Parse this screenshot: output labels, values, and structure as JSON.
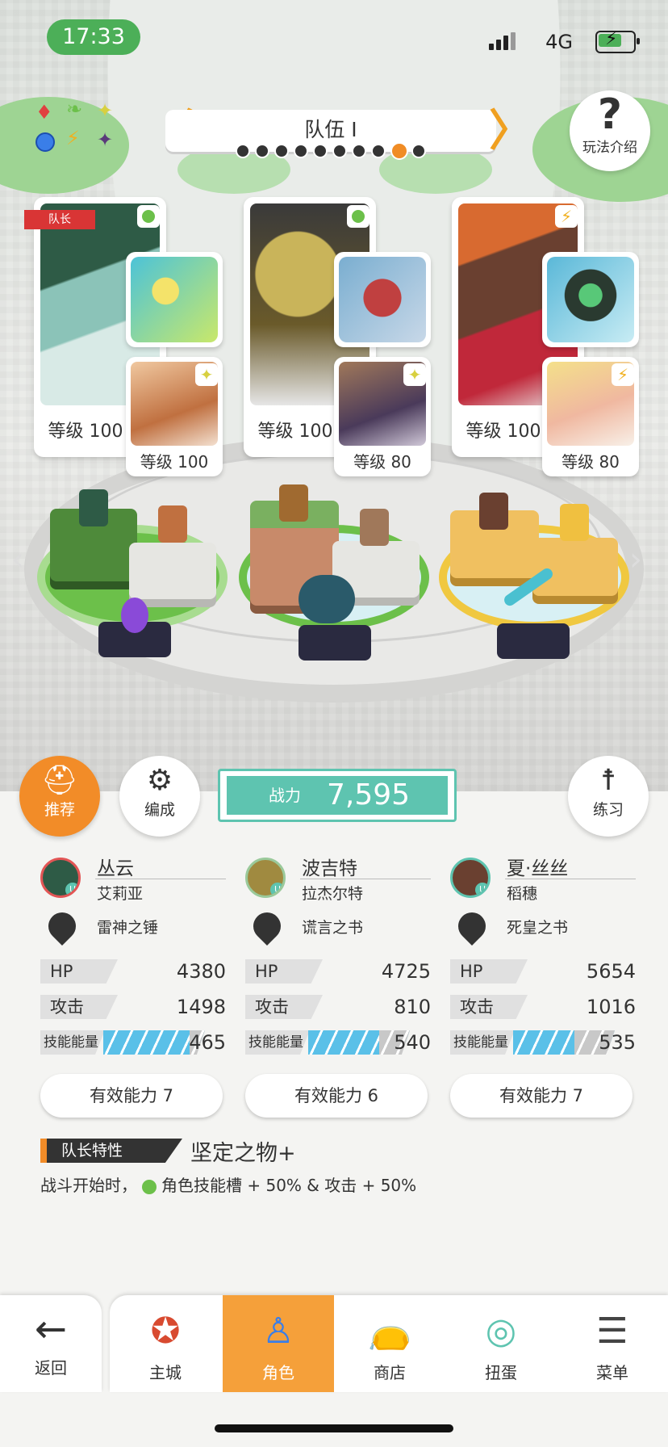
{
  "status_bar": {
    "time": "17:33",
    "network": "4G"
  },
  "header": {
    "team_title": "队伍 I",
    "page_count": 10,
    "current_page_index": 8,
    "help_label": "玩法介绍"
  },
  "leader_tag": "队长",
  "characters": [
    {
      "level": "等级 100",
      "item_level_sub": "等级 100",
      "name": "丛云",
      "alias": "艾莉亚",
      "weapon": "雷神之锤",
      "hp_label": "HP",
      "hp": "4380",
      "atk_label": "攻击",
      "atk": "1498",
      "energy_label": "技能能量",
      "energy": "465",
      "energy_fill": 0.85,
      "effect": "有效能力 7",
      "element_color": "#6cc04a",
      "sub_element_color": "#e6d64a",
      "accent": "#e25555"
    },
    {
      "level": "等级 100",
      "item_level_sub": "等级 80",
      "name": "波吉特",
      "alias": "拉杰尔特",
      "weapon": "谎言之书",
      "hp_label": "HP",
      "hp": "4725",
      "atk_label": "攻击",
      "atk": "810",
      "energy_label": "技能能量",
      "energy": "540",
      "energy_fill": 0.7,
      "effect": "有效能力 6",
      "element_color": "#6cc04a",
      "sub_element_color": "#e6d64a",
      "accent": "#9ac99a"
    },
    {
      "level": "等级 100",
      "item_level_sub": "等级 80",
      "name": "夏·丝丝",
      "alias": "稻穗",
      "weapon": "死皇之书",
      "hp_label": "HP",
      "hp": "5654",
      "atk_label": "攻击",
      "atk": "1016",
      "energy_label": "技能能量",
      "energy": "535",
      "energy_fill": 0.6,
      "effect": "有效能力 7",
      "element_color": "#f0b020",
      "sub_element_color": "#f0b020",
      "accent": "#5ec4b0"
    }
  ],
  "buttons": {
    "recommend": "推荐",
    "formation": "编成",
    "practice": "练习"
  },
  "power": {
    "label": "战力",
    "value": "7,595"
  },
  "leader_trait": {
    "label": "队长特性",
    "name": "坚定之物+",
    "desc_prefix": "战斗开始时，",
    "desc_suffix": "角色技能槽 + 50% & 攻击 + 50%"
  },
  "tabbar": {
    "back": "返回",
    "tabs": [
      "主城",
      "角色",
      "商店",
      "扭蛋",
      "菜单"
    ],
    "active_index": 1
  }
}
